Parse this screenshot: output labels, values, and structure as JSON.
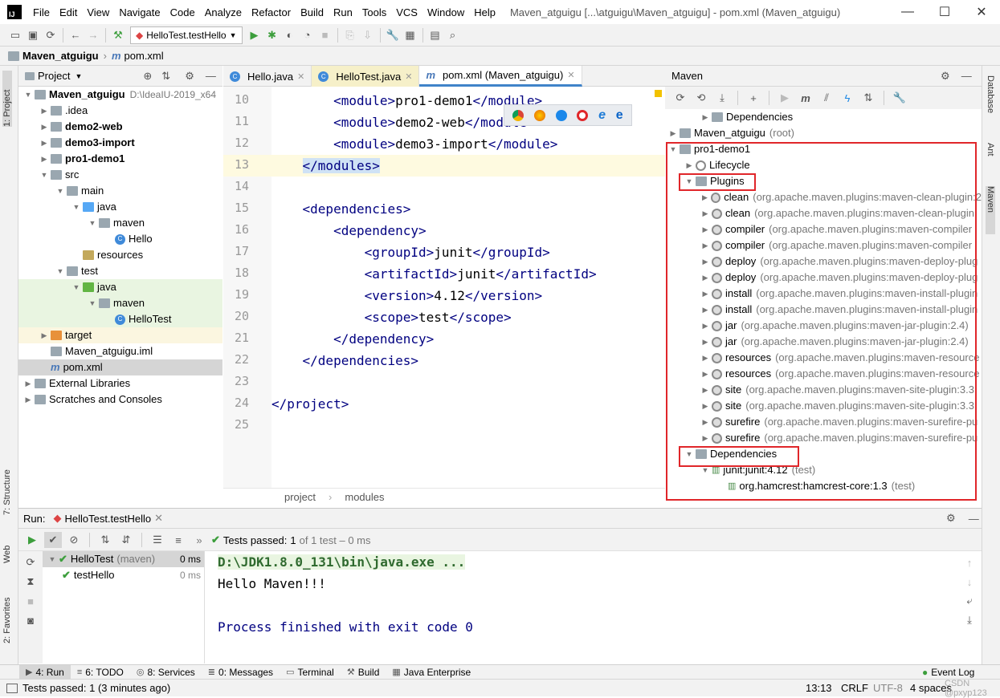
{
  "window": {
    "title": "Maven_atguigu [...\\atguigu\\Maven_atguigu] - pom.xml (Maven_atguigu)",
    "app_icon": "IJ",
    "minimize": "—",
    "maximize": "☐",
    "close": "✕"
  },
  "menu": [
    "File",
    "Edit",
    "View",
    "Navigate",
    "Code",
    "Analyze",
    "Refactor",
    "Build",
    "Run",
    "Tools",
    "VCS",
    "Window",
    "Help"
  ],
  "toolbar": {
    "run_config": "HelloTest.testHello"
  },
  "navbar": {
    "project": "Maven_atguigu",
    "file": "pom.xml"
  },
  "project_panel": {
    "title": "Project",
    "tree": [
      {
        "label": "Maven_atguigu",
        "extra": "D:\\IdeaIU-2019_x64",
        "bold": true,
        "icon": "module-folder-icon",
        "indent": 0,
        "arrow": "down"
      },
      {
        "label": ".idea",
        "icon": "folder-icon",
        "indent": 1,
        "arrow": "right"
      },
      {
        "label": "demo2-web",
        "bold": true,
        "icon": "module-folder-icon",
        "indent": 1,
        "arrow": "right"
      },
      {
        "label": "demo3-import",
        "bold": true,
        "icon": "module-folder-icon",
        "indent": 1,
        "arrow": "right"
      },
      {
        "label": "pro1-demo1",
        "bold": true,
        "icon": "module-folder-icon",
        "indent": 1,
        "arrow": "right"
      },
      {
        "label": "src",
        "icon": "folder-icon",
        "indent": 1,
        "arrow": "down"
      },
      {
        "label": "main",
        "icon": "folder-icon",
        "indent": 2,
        "arrow": "down"
      },
      {
        "label": "java",
        "icon": "source-folder-icon",
        "indent": 3,
        "arrow": "down"
      },
      {
        "label": "maven",
        "icon": "package-icon",
        "indent": 4,
        "arrow": "down"
      },
      {
        "label": "Hello",
        "icon": "class-icon",
        "indent": 5,
        "arrow": ""
      },
      {
        "label": "resources",
        "icon": "resources-folder-icon",
        "indent": 3,
        "arrow": ""
      },
      {
        "label": "test",
        "icon": "folder-icon",
        "indent": 2,
        "arrow": "down"
      },
      {
        "label": "java",
        "icon": "test-folder-icon",
        "indent": 3,
        "arrow": "down",
        "hl": true
      },
      {
        "label": "maven",
        "icon": "package-icon",
        "indent": 4,
        "arrow": "down",
        "hl": true
      },
      {
        "label": "HelloTest",
        "icon": "class-icon",
        "indent": 5,
        "arrow": "",
        "hl": true
      },
      {
        "label": "target",
        "icon": "excluded-folder-icon",
        "indent": 1,
        "arrow": "right",
        "hly": true
      },
      {
        "label": "Maven_atguigu.iml",
        "icon": "iml-file-icon",
        "indent": 1,
        "arrow": ""
      },
      {
        "label": "pom.xml",
        "icon": "maven-file-icon",
        "indent": 1,
        "arrow": "",
        "selected": true
      },
      {
        "label": "External Libraries",
        "icon": "libraries-icon",
        "indent": 0,
        "arrow": "right"
      },
      {
        "label": "Scratches and Consoles",
        "icon": "scratches-icon",
        "indent": 0,
        "arrow": "right"
      }
    ]
  },
  "editor": {
    "tabs": [
      {
        "label": "Hello.java",
        "icon": "class-icon"
      },
      {
        "label": "HelloTest.java",
        "icon": "class-icon",
        "hl": true
      },
      {
        "label": "pom.xml (Maven_atguigu)",
        "icon": "maven-file-icon",
        "active": true
      }
    ],
    "lines": [
      {
        "n": "10",
        "pre": "        ",
        "o": "<module>",
        "t": "pro1-demo1",
        "c": "</module>"
      },
      {
        "n": "11",
        "pre": "        ",
        "o": "<module>",
        "t": "demo2-web",
        "c": "</module>"
      },
      {
        "n": "12",
        "pre": "        ",
        "o": "<module>",
        "t": "demo3-import",
        "c": "</module>"
      },
      {
        "n": "13",
        "pre": "    ",
        "o": "</modules>",
        "t": "",
        "c": "",
        "current": true
      },
      {
        "n": "14",
        "pre": "",
        "o": "",
        "t": "",
        "c": ""
      },
      {
        "n": "15",
        "pre": "    ",
        "o": "<dependencies>",
        "t": "",
        "c": ""
      },
      {
        "n": "16",
        "pre": "        ",
        "o": "<dependency>",
        "t": "",
        "c": ""
      },
      {
        "n": "17",
        "pre": "            ",
        "o": "<groupId>",
        "t": "junit",
        "c": "</groupId>"
      },
      {
        "n": "18",
        "pre": "            ",
        "o": "<artifactId>",
        "t": "junit",
        "c": "</artifactId>"
      },
      {
        "n": "19",
        "pre": "            ",
        "o": "<version>",
        "t": "4.12",
        "c": "</version>"
      },
      {
        "n": "20",
        "pre": "            ",
        "o": "<scope>",
        "t": "test",
        "c": "</scope>"
      },
      {
        "n": "21",
        "pre": "        ",
        "o": "</dependency>",
        "t": "",
        "c": ""
      },
      {
        "n": "22",
        "pre": "    ",
        "o": "</dependencies>",
        "t": "",
        "c": ""
      },
      {
        "n": "23",
        "pre": "",
        "o": "",
        "t": "",
        "c": ""
      },
      {
        "n": "24",
        "pre": "",
        "o": "</project>",
        "t": "",
        "c": ""
      },
      {
        "n": "25",
        "pre": "",
        "o": "",
        "t": "",
        "c": ""
      }
    ],
    "breadcrumb": [
      "project",
      "modules"
    ]
  },
  "maven_panel": {
    "title": "Maven",
    "tree": [
      {
        "label": "Dependencies",
        "dim": "",
        "indent": 2,
        "arrow": "right",
        "icon": "dependencies-icon"
      },
      {
        "label": "Maven_atguigu",
        "dim": "(root)",
        "indent": 0,
        "arrow": "right",
        "icon": "maven-module-icon"
      },
      {
        "label": "pro1-demo1",
        "dim": "",
        "indent": 0,
        "arrow": "down",
        "icon": "maven-module-icon"
      },
      {
        "label": "Lifecycle",
        "dim": "",
        "indent": 1,
        "arrow": "right",
        "icon": "lifecycle-icon"
      },
      {
        "label": "Plugins",
        "dim": "",
        "indent": 1,
        "arrow": "down",
        "icon": "plugins-icon"
      },
      {
        "label": "clean",
        "dim": "(org.apache.maven.plugins:maven-clean-plugin:2",
        "indent": 2,
        "arrow": "right",
        "icon": "plugin-icon"
      },
      {
        "label": "clean",
        "dim": "(org.apache.maven.plugins:maven-clean-plugin",
        "indent": 2,
        "arrow": "right",
        "icon": "plugin-icon"
      },
      {
        "label": "compiler",
        "dim": "(org.apache.maven.plugins:maven-compiler",
        "indent": 2,
        "arrow": "right",
        "icon": "plugin-icon"
      },
      {
        "label": "compiler",
        "dim": "(org.apache.maven.plugins:maven-compiler",
        "indent": 2,
        "arrow": "right",
        "icon": "plugin-icon"
      },
      {
        "label": "deploy",
        "dim": "(org.apache.maven.plugins:maven-deploy-plug",
        "indent": 2,
        "arrow": "right",
        "icon": "plugin-icon"
      },
      {
        "label": "deploy",
        "dim": "(org.apache.maven.plugins:maven-deploy-plug",
        "indent": 2,
        "arrow": "right",
        "icon": "plugin-icon"
      },
      {
        "label": "install",
        "dim": "(org.apache.maven.plugins:maven-install-plugin",
        "indent": 2,
        "arrow": "right",
        "icon": "plugin-icon"
      },
      {
        "label": "install",
        "dim": "(org.apache.maven.plugins:maven-install-plugin",
        "indent": 2,
        "arrow": "right",
        "icon": "plugin-icon"
      },
      {
        "label": "jar",
        "dim": "(org.apache.maven.plugins:maven-jar-plugin:2.4)",
        "indent": 2,
        "arrow": "right",
        "icon": "plugin-icon"
      },
      {
        "label": "jar",
        "dim": "(org.apache.maven.plugins:maven-jar-plugin:2.4)",
        "indent": 2,
        "arrow": "right",
        "icon": "plugin-icon"
      },
      {
        "label": "resources",
        "dim": "(org.apache.maven.plugins:maven-resource",
        "indent": 2,
        "arrow": "right",
        "icon": "plugin-icon"
      },
      {
        "label": "resources",
        "dim": "(org.apache.maven.plugins:maven-resource",
        "indent": 2,
        "arrow": "right",
        "icon": "plugin-icon"
      },
      {
        "label": "site",
        "dim": "(org.apache.maven.plugins:maven-site-plugin:3.3",
        "indent": 2,
        "arrow": "right",
        "icon": "plugin-icon"
      },
      {
        "label": "site",
        "dim": "(org.apache.maven.plugins:maven-site-plugin:3.3",
        "indent": 2,
        "arrow": "right",
        "icon": "plugin-icon"
      },
      {
        "label": "surefire",
        "dim": "(org.apache.maven.plugins:maven-surefire-pu",
        "indent": 2,
        "arrow": "right",
        "icon": "plugin-icon"
      },
      {
        "label": "surefire",
        "dim": "(org.apache.maven.plugins:maven-surefire-pu",
        "indent": 2,
        "arrow": "right",
        "icon": "plugin-icon"
      },
      {
        "label": "Dependencies",
        "dim": "",
        "indent": 1,
        "arrow": "down",
        "icon": "dependencies-icon"
      },
      {
        "label": "junit:junit:4.12",
        "dim": "(test)",
        "indent": 2,
        "arrow": "down",
        "icon": "library-icon"
      },
      {
        "label": "org.hamcrest:hamcrest-core:1.3",
        "dim": "(test)",
        "indent": 3,
        "arrow": "",
        "icon": "library-icon"
      }
    ]
  },
  "run_panel": {
    "label": "Run:",
    "config": "HelloTest.testHello",
    "tests_passed_label": "Tests passed:",
    "tests_passed_count": "1",
    "tests_passed_rest": "of 1 test – 0 ms",
    "tests": [
      {
        "label": "HelloTest",
        "dim": "(maven)",
        "time": "0 ms"
      },
      {
        "label": "testHello",
        "dim": "",
        "time": "0 ms"
      }
    ],
    "console": [
      "D:\\JDK1.8.0_131\\bin\\java.exe ...",
      "Hello Maven!!!",
      "",
      "Process finished with exit code 0"
    ]
  },
  "side_tabs": {
    "left": [
      "1: Project",
      "7: Structure",
      "Web",
      "2: Favorites"
    ],
    "right": [
      "Database",
      "Ant",
      "Maven"
    ]
  },
  "bottom_tabs": [
    {
      "label": "4: Run",
      "active": true
    },
    {
      "label": "6: TODO"
    },
    {
      "label": "8: Services"
    },
    {
      "label": "0: Messages"
    },
    {
      "label": "Terminal"
    },
    {
      "label": "Build"
    },
    {
      "label": "Java Enterprise"
    }
  ],
  "event_log": "Event Log",
  "status": {
    "message": "Tests passed: 1 (3 minutes ago)",
    "position": "13:13",
    "line_sep": "CRLF",
    "encoding": "UTF-8",
    "indent": "4 spaces",
    "watermark": "CSDN @pxyp123"
  }
}
